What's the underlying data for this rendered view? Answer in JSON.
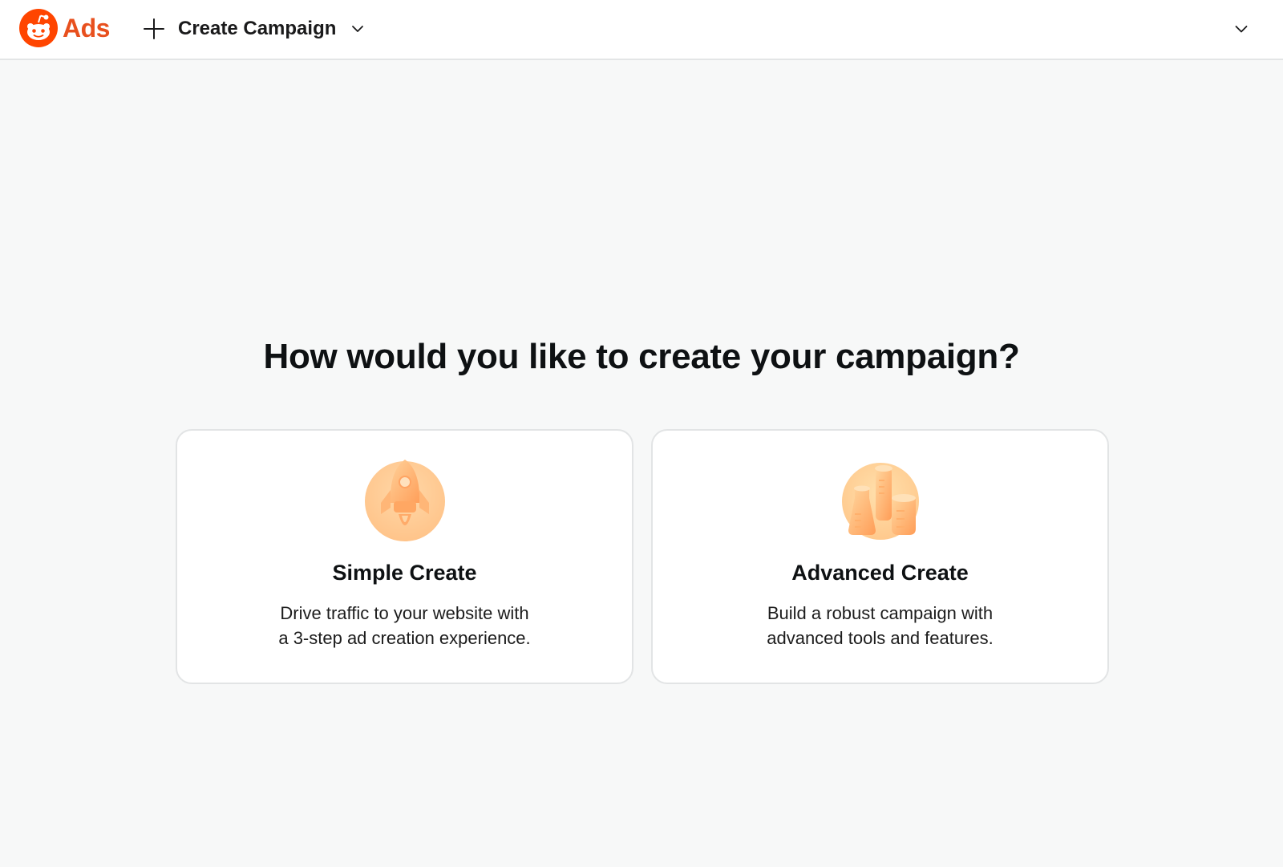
{
  "header": {
    "logo_text": "Ads",
    "create_label": "Create Campaign",
    "brand_color": "#ff4500",
    "icons": [
      "reddit-alien-logo-icon",
      "plus-icon",
      "chevron-down-icon",
      "account-chevron-down-icon"
    ]
  },
  "main": {
    "title": "How would you like to create your campaign?",
    "options": [
      {
        "title": "Simple Create",
        "description": [
          "Drive traffic to your website with",
          "a 3-step ad creation experience."
        ],
        "icon": "rocket-icon"
      },
      {
        "title": "Advanced Create",
        "description": [
          "Build a robust campaign with",
          "advanced tools and features."
        ],
        "icon": "beakers-icon"
      }
    ]
  },
  "colors": {
    "page_background": "#f7f8f8",
    "card_border": "#e2e4e5",
    "accent": "#e8501e"
  }
}
